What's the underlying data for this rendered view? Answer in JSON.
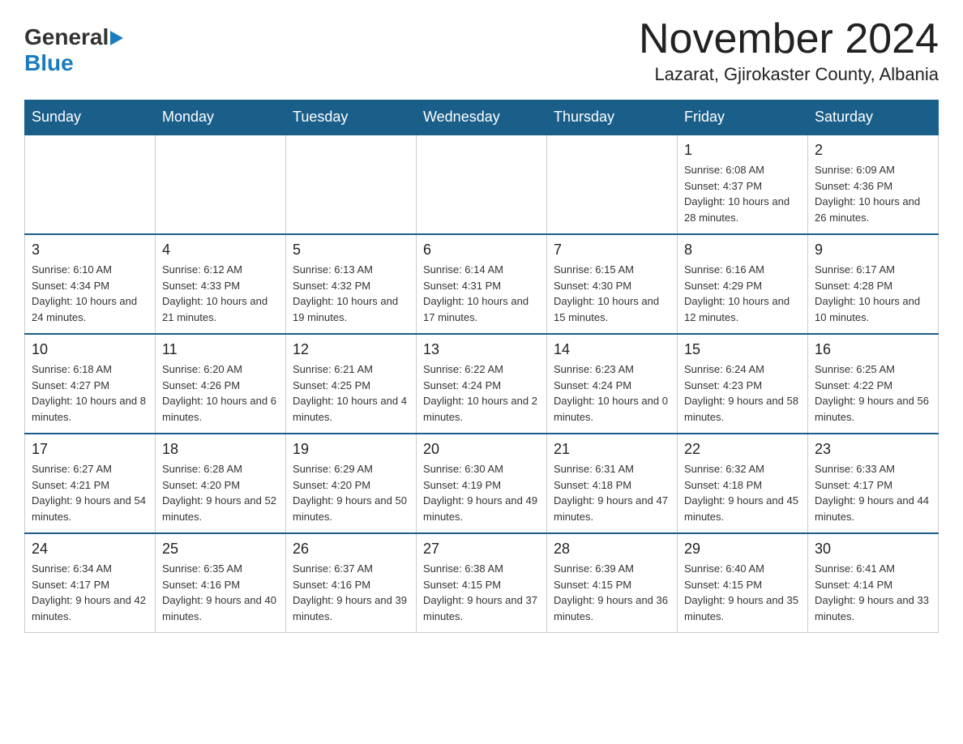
{
  "logo": {
    "general": "General",
    "blue": "Blue"
  },
  "title": "November 2024",
  "subtitle": "Lazarat, Gjirokaster County, Albania",
  "weekdays": [
    "Sunday",
    "Monday",
    "Tuesday",
    "Wednesday",
    "Thursday",
    "Friday",
    "Saturday"
  ],
  "weeks": [
    [
      {
        "day": "",
        "info": ""
      },
      {
        "day": "",
        "info": ""
      },
      {
        "day": "",
        "info": ""
      },
      {
        "day": "",
        "info": ""
      },
      {
        "day": "",
        "info": ""
      },
      {
        "day": "1",
        "info": "Sunrise: 6:08 AM\nSunset: 4:37 PM\nDaylight: 10 hours and 28 minutes."
      },
      {
        "day": "2",
        "info": "Sunrise: 6:09 AM\nSunset: 4:36 PM\nDaylight: 10 hours and 26 minutes."
      }
    ],
    [
      {
        "day": "3",
        "info": "Sunrise: 6:10 AM\nSunset: 4:34 PM\nDaylight: 10 hours and 24 minutes."
      },
      {
        "day": "4",
        "info": "Sunrise: 6:12 AM\nSunset: 4:33 PM\nDaylight: 10 hours and 21 minutes."
      },
      {
        "day": "5",
        "info": "Sunrise: 6:13 AM\nSunset: 4:32 PM\nDaylight: 10 hours and 19 minutes."
      },
      {
        "day": "6",
        "info": "Sunrise: 6:14 AM\nSunset: 4:31 PM\nDaylight: 10 hours and 17 minutes."
      },
      {
        "day": "7",
        "info": "Sunrise: 6:15 AM\nSunset: 4:30 PM\nDaylight: 10 hours and 15 minutes."
      },
      {
        "day": "8",
        "info": "Sunrise: 6:16 AM\nSunset: 4:29 PM\nDaylight: 10 hours and 12 minutes."
      },
      {
        "day": "9",
        "info": "Sunrise: 6:17 AM\nSunset: 4:28 PM\nDaylight: 10 hours and 10 minutes."
      }
    ],
    [
      {
        "day": "10",
        "info": "Sunrise: 6:18 AM\nSunset: 4:27 PM\nDaylight: 10 hours and 8 minutes."
      },
      {
        "day": "11",
        "info": "Sunrise: 6:20 AM\nSunset: 4:26 PM\nDaylight: 10 hours and 6 minutes."
      },
      {
        "day": "12",
        "info": "Sunrise: 6:21 AM\nSunset: 4:25 PM\nDaylight: 10 hours and 4 minutes."
      },
      {
        "day": "13",
        "info": "Sunrise: 6:22 AM\nSunset: 4:24 PM\nDaylight: 10 hours and 2 minutes."
      },
      {
        "day": "14",
        "info": "Sunrise: 6:23 AM\nSunset: 4:24 PM\nDaylight: 10 hours and 0 minutes."
      },
      {
        "day": "15",
        "info": "Sunrise: 6:24 AM\nSunset: 4:23 PM\nDaylight: 9 hours and 58 minutes."
      },
      {
        "day": "16",
        "info": "Sunrise: 6:25 AM\nSunset: 4:22 PM\nDaylight: 9 hours and 56 minutes."
      }
    ],
    [
      {
        "day": "17",
        "info": "Sunrise: 6:27 AM\nSunset: 4:21 PM\nDaylight: 9 hours and 54 minutes."
      },
      {
        "day": "18",
        "info": "Sunrise: 6:28 AM\nSunset: 4:20 PM\nDaylight: 9 hours and 52 minutes."
      },
      {
        "day": "19",
        "info": "Sunrise: 6:29 AM\nSunset: 4:20 PM\nDaylight: 9 hours and 50 minutes."
      },
      {
        "day": "20",
        "info": "Sunrise: 6:30 AM\nSunset: 4:19 PM\nDaylight: 9 hours and 49 minutes."
      },
      {
        "day": "21",
        "info": "Sunrise: 6:31 AM\nSunset: 4:18 PM\nDaylight: 9 hours and 47 minutes."
      },
      {
        "day": "22",
        "info": "Sunrise: 6:32 AM\nSunset: 4:18 PM\nDaylight: 9 hours and 45 minutes."
      },
      {
        "day": "23",
        "info": "Sunrise: 6:33 AM\nSunset: 4:17 PM\nDaylight: 9 hours and 44 minutes."
      }
    ],
    [
      {
        "day": "24",
        "info": "Sunrise: 6:34 AM\nSunset: 4:17 PM\nDaylight: 9 hours and 42 minutes."
      },
      {
        "day": "25",
        "info": "Sunrise: 6:35 AM\nSunset: 4:16 PM\nDaylight: 9 hours and 40 minutes."
      },
      {
        "day": "26",
        "info": "Sunrise: 6:37 AM\nSunset: 4:16 PM\nDaylight: 9 hours and 39 minutes."
      },
      {
        "day": "27",
        "info": "Sunrise: 6:38 AM\nSunset: 4:15 PM\nDaylight: 9 hours and 37 minutes."
      },
      {
        "day": "28",
        "info": "Sunrise: 6:39 AM\nSunset: 4:15 PM\nDaylight: 9 hours and 36 minutes."
      },
      {
        "day": "29",
        "info": "Sunrise: 6:40 AM\nSunset: 4:15 PM\nDaylight: 9 hours and 35 minutes."
      },
      {
        "day": "30",
        "info": "Sunrise: 6:41 AM\nSunset: 4:14 PM\nDaylight: 9 hours and 33 minutes."
      }
    ]
  ],
  "colors": {
    "header_bg": "#1a5e8a",
    "header_text": "#ffffff",
    "border": "#1a5e8a",
    "empty_bg": "#f5f5f5"
  }
}
